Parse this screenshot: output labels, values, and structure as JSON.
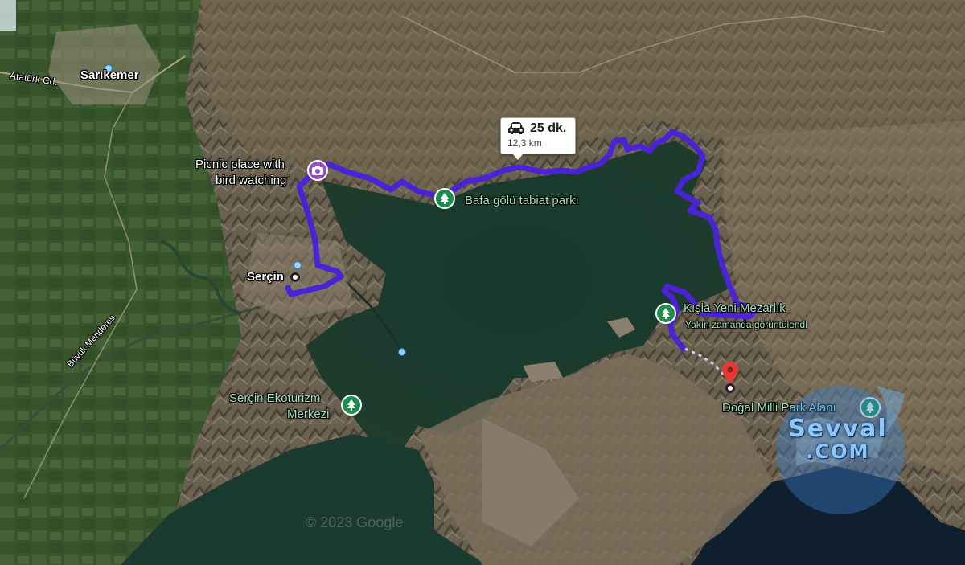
{
  "map": {
    "route_info": {
      "duration": "25 dk.",
      "distance": "12,3 km",
      "mode_icon": "car-icon"
    },
    "places": {
      "sarikemer": "Sarıkemer",
      "ataturk_road": "Atatürk Cd.",
      "picnic_line1": "Picnic place with",
      "picnic_line2": "bird watching",
      "sercin": "Serçin",
      "bafa": "Bafa gölü tabiat parkı",
      "kisla": "Kışla Yeni Mezarlık",
      "kisla_sub": "Yakın zamanda görüntülendi",
      "sercin_eko_line1": "Serçin Ekoturizm",
      "sercin_eko_line2": "Merkezi",
      "dogal": "Doğal Milli Park Alanı",
      "river": "Büyük Menderes"
    },
    "watermark": {
      "line1": "Sevval",
      "line2": ".COM"
    },
    "copyright": "© 2023 Google",
    "colors": {
      "route": "#4a23d6",
      "park_pin": "#1e8e4e",
      "photo_pin": "#9a49c7",
      "destination_pin": "#e53935",
      "water": "#1e3a30"
    }
  }
}
